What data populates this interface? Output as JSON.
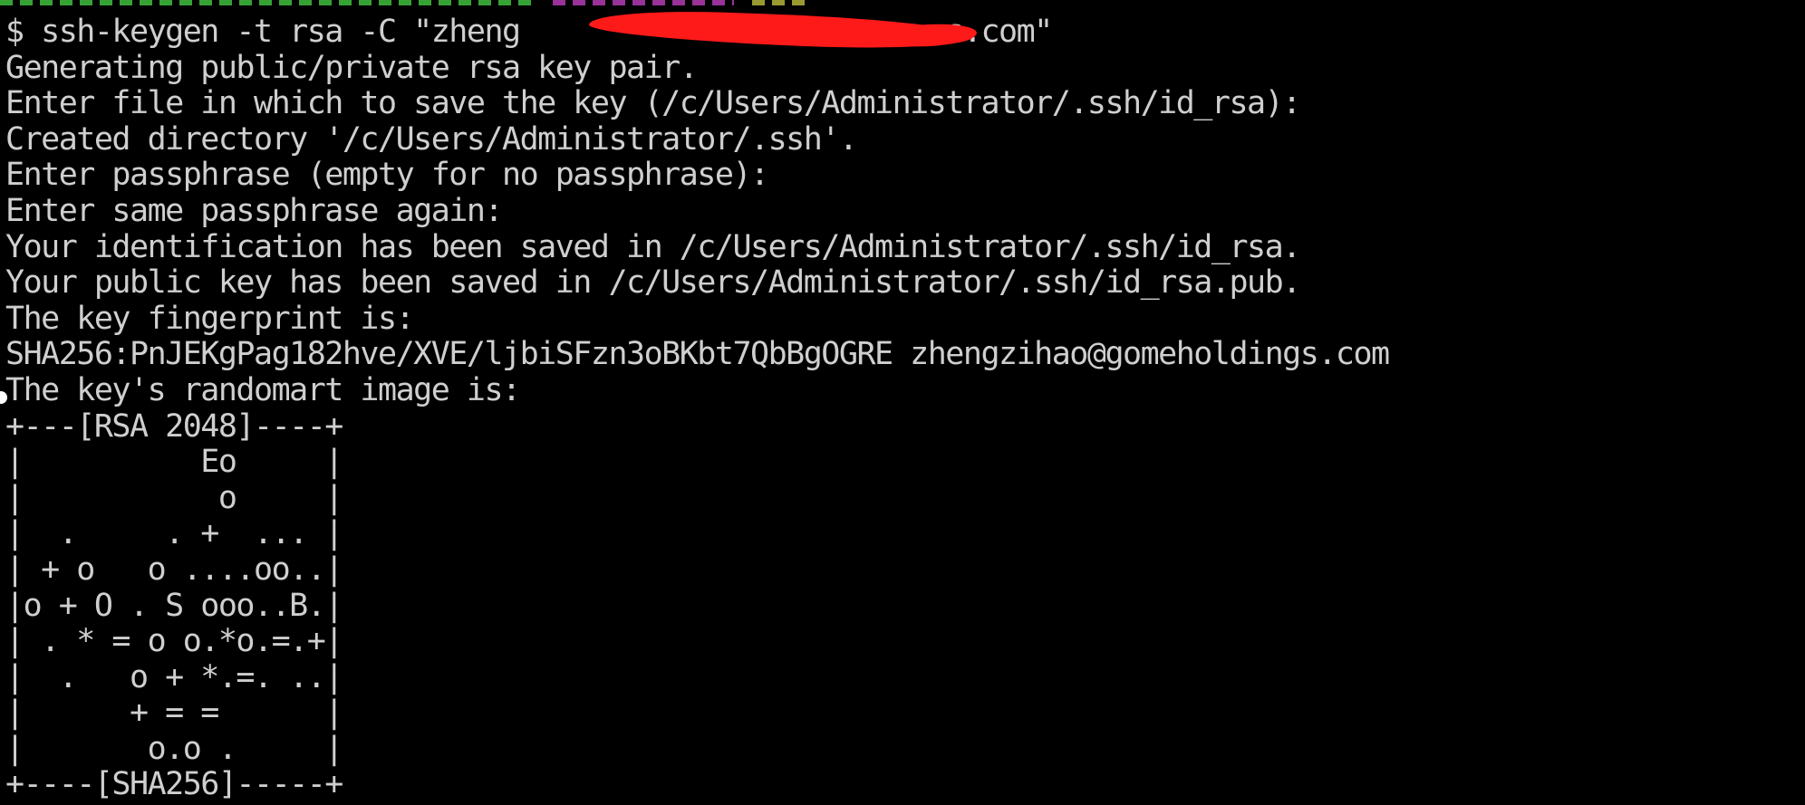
{
  "terminal": {
    "lines": [
      "$ ssh-keygen -t rsa -C \"zheng                        s.com\"",
      "Generating public/private rsa key pair.",
      "Enter file in which to save the key (/c/Users/Administrator/.ssh/id_rsa):",
      "Created directory '/c/Users/Administrator/.ssh'.",
      "Enter passphrase (empty for no passphrase):",
      "Enter same passphrase again:",
      "Your identification has been saved in /c/Users/Administrator/.ssh/id_rsa.",
      "Your public key has been saved in /c/Users/Administrator/.ssh/id_rsa.pub.",
      "The key fingerprint is:",
      "SHA256:PnJEKgPag182hve/XVE/ljbiSFzn3oBKbt7QbBgOGRE zhengzihao@gomeholdings.com",
      "The key's randomart image is:",
      "+---[RSA 2048]----+",
      "|          Eo     |",
      "|           o     |",
      "|  .     . +  ... |",
      "| + o   o ....oo..|",
      "|o + O . S ooo..B.|",
      "| . * = o o.*o.=.+|",
      "|  .   o + *.=. ..|",
      "|      + = =      |",
      "|       o.o .     |",
      "+----[SHA256]-----+"
    ],
    "colors": {
      "background": "#000000",
      "text": "#cfcfcf",
      "redaction": "#ff1a1a"
    }
  }
}
